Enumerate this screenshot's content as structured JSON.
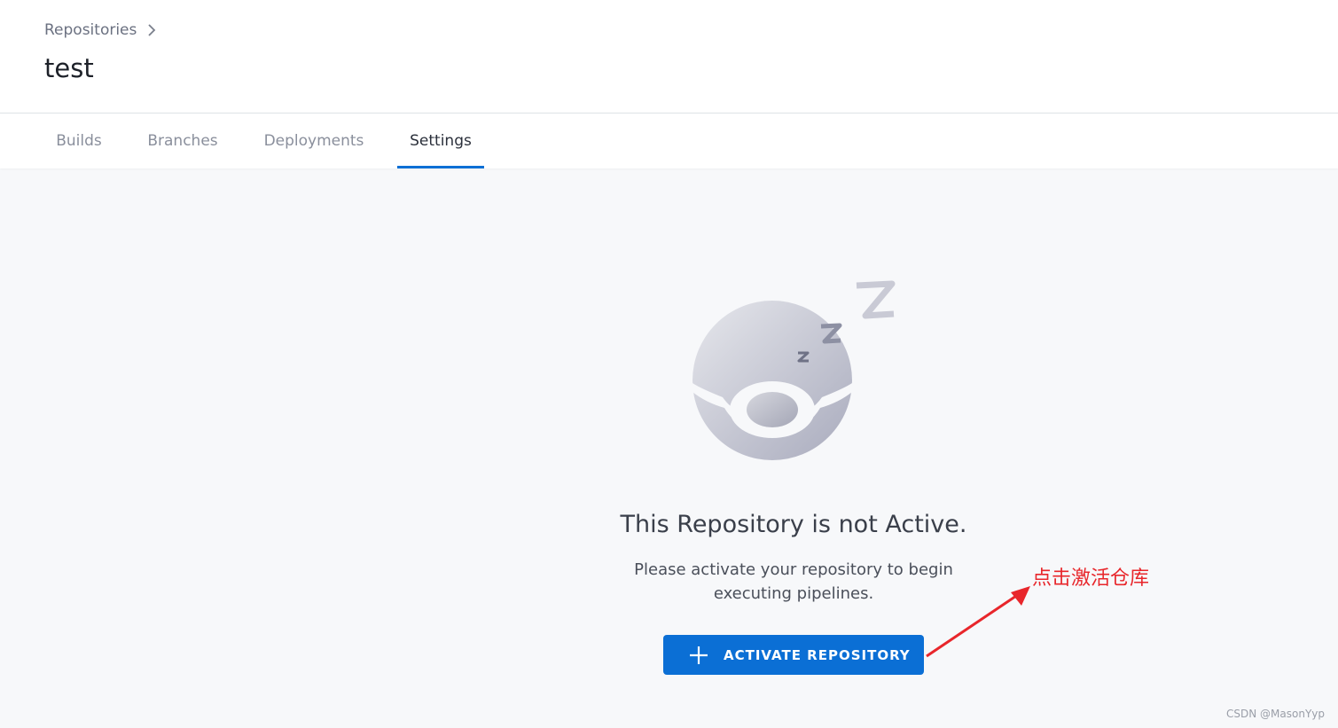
{
  "header": {
    "breadcrumb": "Repositories",
    "title": "test"
  },
  "tabs": [
    {
      "label": "Builds"
    },
    {
      "label": "Branches"
    },
    {
      "label": "Deployments"
    },
    {
      "label": "Settings",
      "active": true
    }
  ],
  "empty_state": {
    "title": "This Repository is not Active.",
    "description": "Please activate your repository to begin executing pipelines.",
    "button_label": "ACTIVATE REPOSITORY"
  },
  "annotation": {
    "text": "点击激活仓库",
    "color": "#e8262b"
  },
  "watermark": "CSDN @MasonYyp",
  "colors": {
    "accent": "#0b6fd5",
    "background": "#f7f8fa"
  }
}
